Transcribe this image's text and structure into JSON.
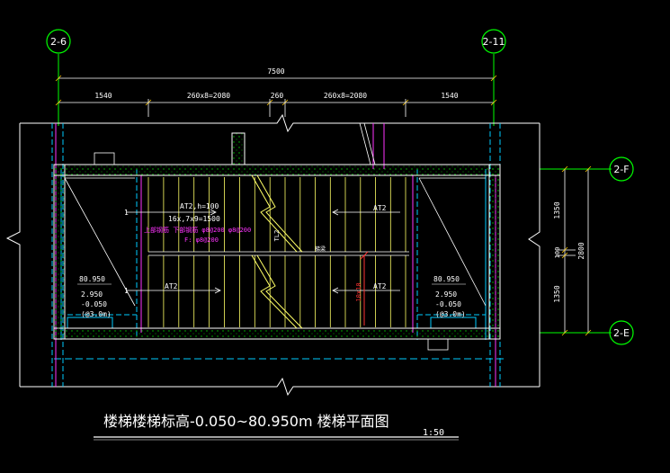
{
  "grid": {
    "axis_left": "2-6",
    "axis_right": "2-11",
    "axis_top": "2-F",
    "axis_bottom": "2-E"
  },
  "dimensions": {
    "overall": "7500",
    "seg_1": "1540",
    "seg_2": "260x8=2080",
    "seg_3": "260",
    "seg_4": "260x8=2080",
    "seg_5": "1540",
    "right_1": "1350",
    "right_2": "100",
    "right_3": "1350",
    "right_total": "2800"
  },
  "labels": {
    "at2_header": "AT2,h=100",
    "at2_spec": "16x,7x9=1500",
    "mag_line_1": "上部钢筋 下部钢筋 φ8@200 φ8@200",
    "mag_line_2": "F: φ8@200",
    "flight_upper_right": "AT2",
    "flight_lower_left": "AT2",
    "flight_lower_right": "AT2",
    "landing_left_elev1": "80.950",
    "landing_left_elev2": "2.950",
    "landing_left_elev3": "-0.050",
    "landing_left_note": "(@3.0m)",
    "landing_right_elev1": "80.950",
    "landing_right_elev2": "2.950",
    "landing_right_elev3": "-0.050",
    "landing_right_note": "(@3.0m)",
    "tl": "TL2",
    "mid_beam": "梯梁",
    "red_dim": "10x10",
    "arrow_i": "1"
  },
  "title": {
    "text": "楼梯楼梯标高-0.050~80.950m 楼梯平面图",
    "scale": "1:50"
  },
  "colors": {
    "background": "#000000",
    "wall": "#ffffff",
    "hatch": "#00cc00",
    "step": "#ffff66",
    "dim": "#ffffff",
    "dim_tick": "#ffcc00",
    "magenta": "#ff33ff",
    "cyan": "#00ccff",
    "grid_bubble": "#00ff00",
    "red": "#ff3333"
  }
}
